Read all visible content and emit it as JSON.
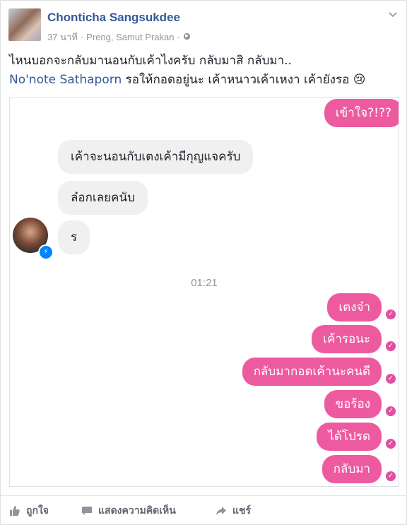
{
  "post": {
    "author": "Chonticha Sangsukdee",
    "time": "37 นาที",
    "separator": "·",
    "location": "Preng, Samut Prakan",
    "separator2": "·",
    "text_line1": "ไหนบอกจะกลับมานอนกับเค้าไงครับ กลับมาสิ กลับมา..",
    "tag": "No'note Sathaporn",
    "text_line2_rest": " รอให้กอดอยู่นะ เค้าหนาวเค้าเหงา เค้ายังรอ ",
    "emoji": "😢"
  },
  "chat": {
    "top_right": "เข้าใจ?!??",
    "left_messages": [
      "เค้าจะนอนกับเตงเค้ามีกุญแจครับ",
      "ล๋อกเลยคนับ",
      "ร"
    ],
    "timestamp": "01:21",
    "right_messages": [
      "เตงจ๋า",
      "เค้ารอนะ",
      "กลับมากอดเค้านะคนดี",
      "ขอร้อง",
      "ได้โปรด",
      "กลับมา"
    ]
  },
  "actions": {
    "like": "ถูกใจ",
    "comment": "แสดงความคิดเห็น",
    "share": "แชร์"
  },
  "colors": {
    "link": "#365899",
    "bubble_pink": "#ee5aa0",
    "bubble_gray": "#f1f0f0"
  }
}
